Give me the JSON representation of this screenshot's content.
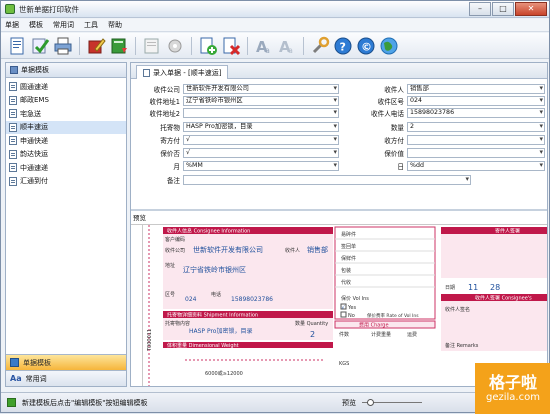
{
  "window": {
    "title": "世新单据打印软件",
    "min": "–",
    "max": "□",
    "close": "✕"
  },
  "menu": [
    "单据",
    "模板",
    "常用词",
    "工具",
    "帮助"
  ],
  "toolbar": {
    "icons": [
      "new-doc-icon",
      "check-icon",
      "print-icon",
      "edit-icon",
      "book-icon",
      "template-icon",
      "settings-icon",
      "add-icon",
      "delete-icon",
      "font-a-icon",
      "font-b-icon",
      "wrench-icon",
      "help-icon",
      "info-icon",
      "globe-icon"
    ]
  },
  "nav": {
    "header": "单据模板",
    "items": [
      "圆通速递",
      "邮政EMS",
      "宅急送",
      "顺丰速运",
      "申通快递",
      "韵达快运",
      "中通速递",
      "汇通到付"
    ],
    "selected_index": 3,
    "bottom_tabs": [
      "单据模板",
      "常用词"
    ]
  },
  "main": {
    "tab_label": "录入单据 - [顺丰速运]",
    "form": {
      "left": [
        {
          "label": "收件公司",
          "value": "世新软件开发有限公司",
          "dropdown": true
        },
        {
          "label": "收件地址1",
          "value": "辽宁省铁岭市银州区",
          "dropdown": true
        },
        {
          "label": "收件地址2",
          "value": "",
          "dropdown": true
        },
        {
          "label": "托寄物",
          "value": "HASP Pro加密锁，目录",
          "dropdown": true
        },
        {
          "label": "寄方付",
          "value": "√",
          "dropdown": true
        },
        {
          "label": "保价否",
          "value": "√",
          "dropdown": true
        },
        {
          "label": "月",
          "value": "%MM",
          "dropdown": true
        },
        {
          "label": "备注",
          "value": "",
          "dropdown": true
        }
      ],
      "right": [
        {
          "label": "收件人",
          "value": "销售部",
          "dropdown": true
        },
        {
          "label": "收件区号",
          "value": "024",
          "dropdown": true
        },
        {
          "label": "收件人电话",
          "value": "15898023786",
          "dropdown": true
        },
        {
          "label": "数量",
          "value": "2",
          "dropdown": true
        },
        {
          "label": "收方付",
          "value": "",
          "dropdown": true
        },
        {
          "label": "保价值",
          "value": "",
          "dropdown": true
        },
        {
          "label": "日",
          "value": "%dd",
          "dropdown": true
        }
      ]
    },
    "preview": {
      "label": "预览",
      "consignee_header": "收件人信息 Consignee Information",
      "customer_code": "客户编码",
      "company_label": "收件公司",
      "company": "世新软件开发有限公司",
      "contact_label": "收件人",
      "contact": "销售部",
      "address_label": "地址",
      "address": "辽宁省铁岭市银州区",
      "area_label": "区号",
      "area": "024",
      "phone_label": "电话",
      "phone": "15898023786",
      "shipment_header": "托寄物详细资料 Shipment Information",
      "shipment_label": "托寄物内容",
      "shipment": "HASP Pro加密锁，目录",
      "qty_label": "数量 Quantity",
      "qty": "2",
      "dim_header": "体积重量 Dimensional Weight",
      "dim_formula": "6000或≥12000",
      "charge_header": "费用 Charge",
      "pieces": "件数",
      "weight": "计费重量",
      "fee": "运费",
      "kgs": "KGS",
      "sender_header": "寄件人签署",
      "recipient_header": "收件人签署 Consignee's",
      "recipient_name": "收件人签名",
      "date_label": "日期",
      "month": "11",
      "day": "28",
      "side_code": "T000011",
      "remarks": "备注 Remarks",
      "services": [
        "易碎件",
        "签回单",
        "保鲜件",
        "包装",
        "代收"
      ],
      "value_label": "保价 Vol Ins",
      "value_yes": "Yes",
      "value_no": "No",
      "rate_text": "保价费率 Rate of Vol Ins"
    }
  },
  "status": {
    "text": "新建模板后点击\"编辑模板\"按钮编辑模板",
    "zoom_label": "预览",
    "zoom_value": 0.1
  },
  "watermark": {
    "big": "格子啦",
    "small": "gezila.com"
  },
  "colors": {
    "accent": "#f6b53b",
    "preview_header": "#c0184a",
    "preview_band": "#f2c4d2",
    "link_blue": "#1e4f9c"
  }
}
